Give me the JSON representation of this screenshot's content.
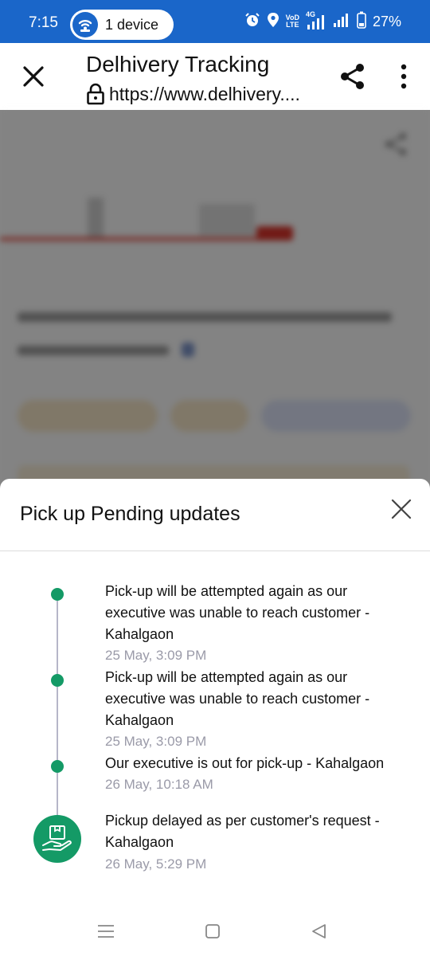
{
  "status_bar": {
    "time": "7:15",
    "device_pill": "1 device",
    "network_label_top": "VoD",
    "network_label_bottom": "LTE",
    "network_type": "4G",
    "battery": "27%",
    "icons": [
      "wifi-share-icon",
      "alarm-icon",
      "location-icon",
      "volte-icon",
      "signal-icon",
      "battery-icon"
    ]
  },
  "toolbar": {
    "title": "Delhivery Tracking",
    "url": "https://www.delhivery....",
    "icons": [
      "close-icon",
      "lock-icon",
      "share-icon",
      "more-vert-icon"
    ]
  },
  "sheet": {
    "title": "Pick up Pending updates",
    "accent_color": "#149a66",
    "updates": [
      {
        "text": "Pick-up will be attempted again as our executive was unable to reach customer - Kahalgaon",
        "time": "25 May, 3:09 PM"
      },
      {
        "text": "Pick-up will be attempted again as our executive was unable to reach customer - Kahalgaon",
        "time": "25 May, 3:09 PM"
      },
      {
        "text": "Our executive is out for pick-up - Kahalgaon",
        "time": "26 May, 10:18 AM"
      },
      {
        "text": "Pickup delayed as per customer's request - Kahalgaon",
        "time": "26 May, 5:29 PM"
      }
    ]
  },
  "nav_bar": {
    "icons": [
      "recents-icon",
      "home-icon",
      "back-icon"
    ]
  }
}
